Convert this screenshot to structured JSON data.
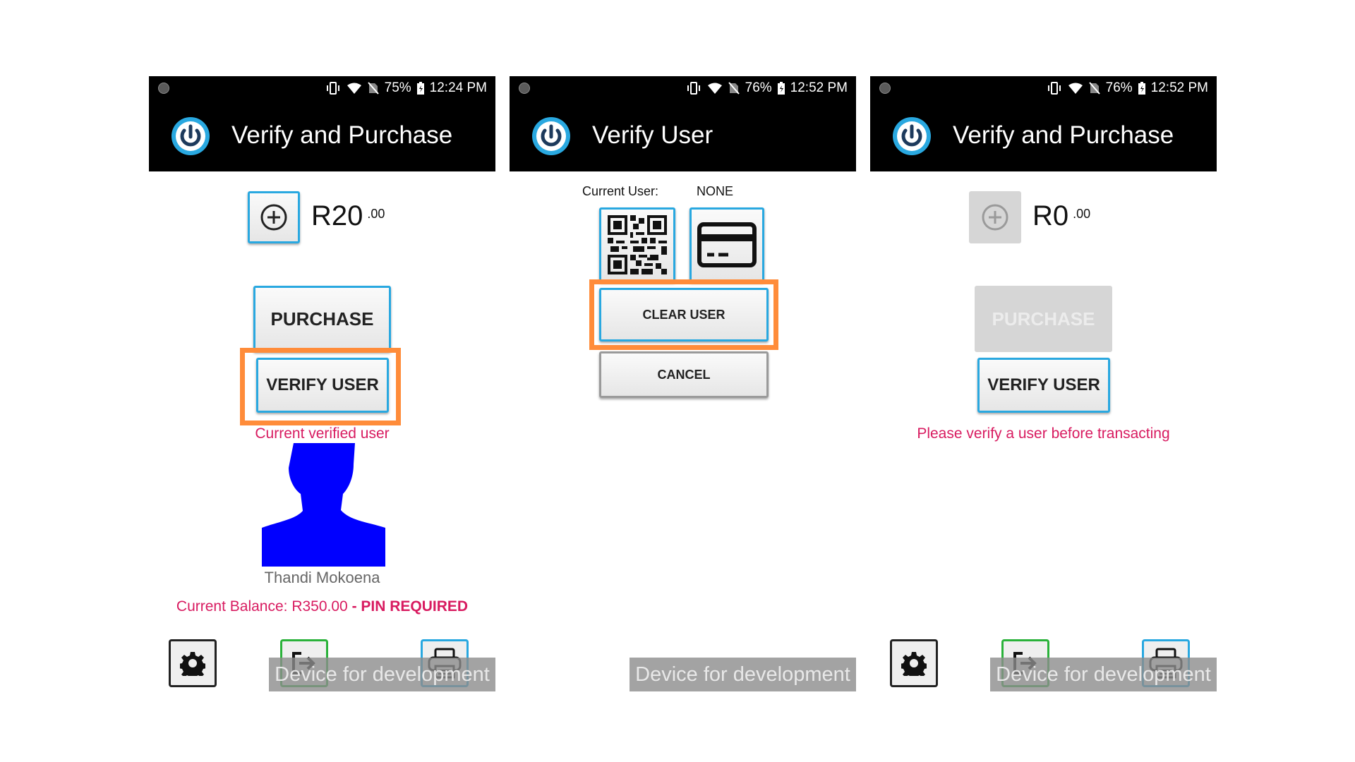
{
  "status_icons": [
    "vibrate-icon",
    "wifi-icon",
    "no-sim-icon",
    "battery-icon"
  ],
  "colors": {
    "accent": "#29a8e0",
    "highlight": "#ff8c3a",
    "warning": "#d81b60",
    "avatar": "#0000ff",
    "ok": "#2ab23a"
  },
  "screens": [
    {
      "status": {
        "battery": "75%",
        "time": "12:24 PM"
      },
      "title": "Verify and Purchase",
      "amount": {
        "main": "R20",
        "cents": ".00"
      },
      "purchase_label": "PURCHASE",
      "verify_label": "VERIFY USER",
      "verified_caption": "Current verified user",
      "user_name": "Thandi Mokoena",
      "balance": {
        "text": "Current Balance: R350.00 ",
        "pin": "- PIN REQUIRED"
      },
      "dev_banner": "Device for development"
    },
    {
      "status": {
        "battery": "76%",
        "time": "12:52 PM"
      },
      "title": "Verify User",
      "current_user_label": "Current User:",
      "current_user_value": "NONE",
      "clear_label": "CLEAR USER",
      "cancel_label": "CANCEL",
      "dev_banner": "Device for development"
    },
    {
      "status": {
        "battery": "76%",
        "time": "12:52 PM"
      },
      "title": "Verify and Purchase",
      "amount": {
        "main": "R0",
        "cents": ".00"
      },
      "purchase_label": "PURCHASE",
      "verify_label": "VERIFY USER",
      "warning": "Please verify a user before transacting",
      "dev_banner": "Device for development"
    }
  ]
}
